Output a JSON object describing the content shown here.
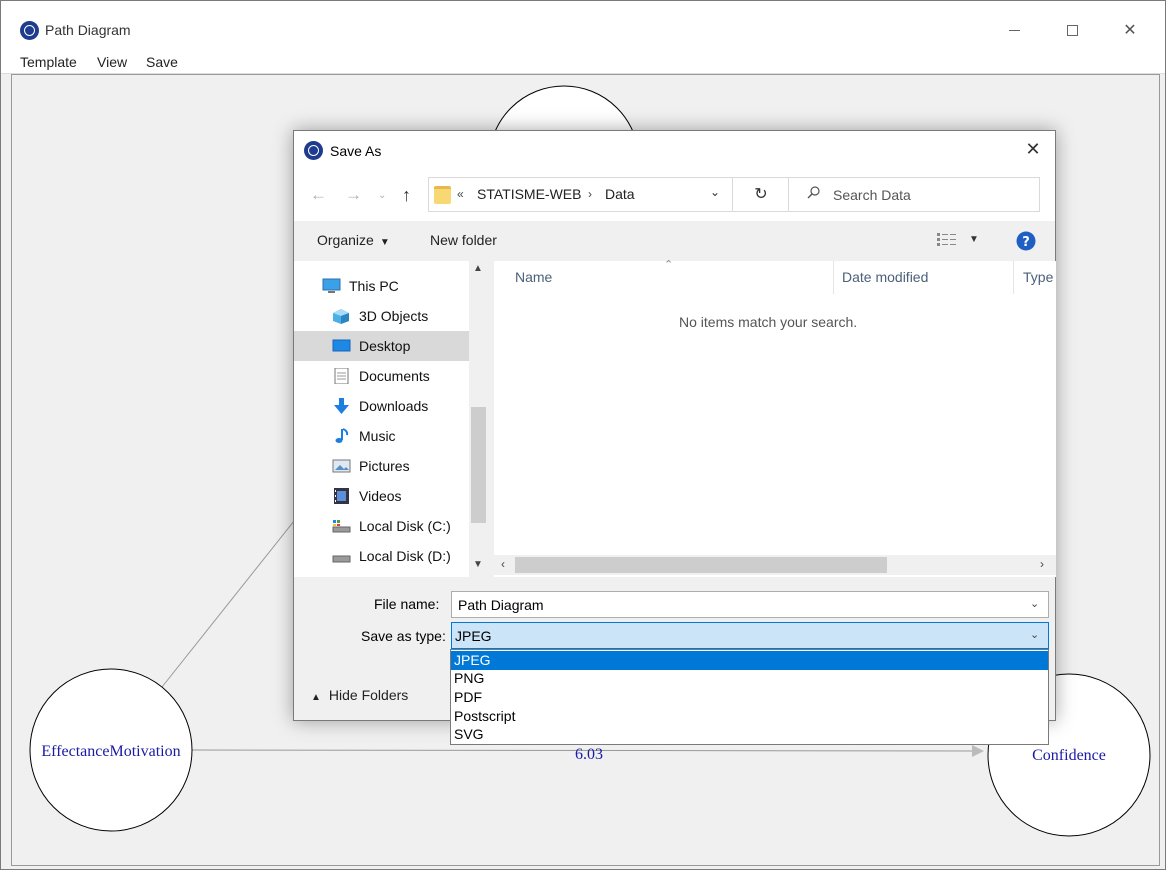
{
  "window": {
    "title": "Path Diagram",
    "close_glyph": "✕"
  },
  "menu": {
    "template": "Template",
    "view": "View",
    "save": "Save"
  },
  "diagram": {
    "nodes": [
      "EffectanceMotivation",
      "Confidence"
    ],
    "edge_label": "6.03",
    "text_color": "#1a1aa6"
  },
  "dialog": {
    "title": "Save As",
    "close_glyph": "✕",
    "nav": {
      "back": "←",
      "forward": "→",
      "recent": "⌄",
      "up": "↑",
      "refresh": "↻"
    },
    "address": {
      "prefix": "«",
      "crumbs": [
        "STATISME-WEB",
        "Data"
      ],
      "separator": "›",
      "dropdown": "⌄"
    },
    "search": {
      "placeholder": "Search Data"
    },
    "toolbar": {
      "organize": "Organize",
      "new_folder": "New folder"
    },
    "nav_pane": {
      "items": [
        {
          "label": "This PC",
          "icon": "pc-icon"
        },
        {
          "label": "3D Objects",
          "icon": "cube-icon"
        },
        {
          "label": "Desktop",
          "icon": "desktop-icon",
          "selected": true
        },
        {
          "label": "Documents",
          "icon": "document-icon"
        },
        {
          "label": "Downloads",
          "icon": "download-icon"
        },
        {
          "label": "Music",
          "icon": "music-icon"
        },
        {
          "label": "Pictures",
          "icon": "picture-icon"
        },
        {
          "label": "Videos",
          "icon": "video-icon"
        },
        {
          "label": "Local Disk (C:)",
          "icon": "disk-icon"
        },
        {
          "label": "Local Disk (D:)",
          "icon": "disk-icon"
        }
      ]
    },
    "file_list": {
      "columns": [
        "Name",
        "Date modified",
        "Type"
      ],
      "empty_message": "No items match your search."
    },
    "filename_label": "File name:",
    "filename_value": "Path Diagram",
    "savetype_label": "Save as type:",
    "savetype_value": "JPEG",
    "hide_folders": "Hide Folders",
    "type_options": [
      "JPEG",
      "PNG",
      "PDF",
      "Postscript",
      "SVG"
    ],
    "active_option": "JPEG",
    "accent_color": "#0078d7"
  }
}
